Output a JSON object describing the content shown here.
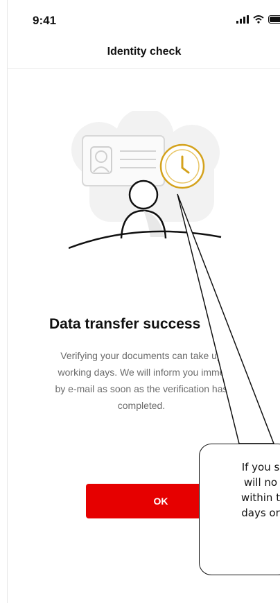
{
  "status_bar": {
    "time": "9:41",
    "icons": [
      "signal-icon",
      "wifi-icon",
      "battery-icon"
    ]
  },
  "header": {
    "title": "Identity check"
  },
  "illustration": {
    "icons": [
      "id-card-icon",
      "clock-icon",
      "person-icon"
    ]
  },
  "content": {
    "title": "Data transfer success",
    "description": "Verifying your documents can take up working days. We will inform you imme by e-mail as soon as the verification has completed.",
    "description_lines": [
      "Verifying your documents can take up",
      "working days. We will inform you imme",
      "by e-mail as soon as the verification has",
      "completed."
    ]
  },
  "actions": {
    "ok_label": "OK"
  },
  "callout": {
    "lines": [
      "If you s",
      "will no",
      "within t",
      "days  or"
    ]
  },
  "colors": {
    "accent": "#e60000",
    "clock": "#d4a21c",
    "text_secondary": "#6b6b6b"
  }
}
